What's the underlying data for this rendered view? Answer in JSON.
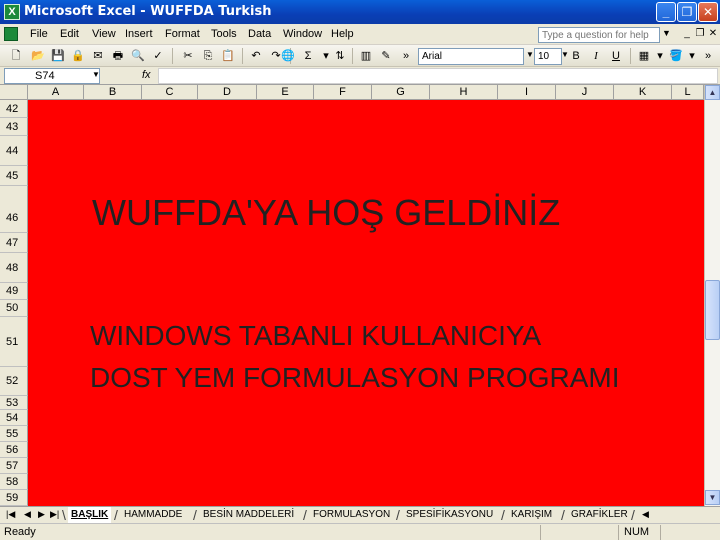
{
  "window": {
    "app_title": "Microsoft Excel",
    "document_title": "WUFFDA Turkish",
    "min_icon": "_",
    "restore_icon": "❐",
    "close_icon": "✕"
  },
  "menu": {
    "items": [
      "File",
      "Edit",
      "View",
      "Insert",
      "Format",
      "Tools",
      "Data",
      "Window",
      "Help"
    ],
    "help_placeholder": "Type a question for help"
  },
  "toolbar": {
    "font_name": "Arial",
    "font_size": "10",
    "bold": "B",
    "italic": "I",
    "underline": "U"
  },
  "formula_bar": {
    "name_box": "S74",
    "fx": "fx",
    "formula": ""
  },
  "grid": {
    "columns": [
      "A",
      "B",
      "C",
      "D",
      "E",
      "F",
      "G",
      "H",
      "I",
      "J",
      "K",
      "L"
    ],
    "rows": [
      "42",
      "43",
      "44",
      "45",
      "46",
      "47",
      "48",
      "49",
      "50",
      "51",
      "52",
      "53",
      "54",
      "55",
      "56",
      "57",
      "58",
      "59"
    ],
    "fill_color": "#ff0000"
  },
  "content": {
    "title": "WUFFDA'YA  HOŞ GELDİNİZ",
    "line1": "WINDOWS TABANLI KULLANICIYA",
    "line2": "DOST YEM FORMULASYON PROGRAMI"
  },
  "sheet_tabs": [
    "BAŞLIK",
    "HAMMADDE",
    "BESİN MADDELERİ",
    "FORMULASYON",
    "SPESİFİKASYONU",
    "KARIŞIM",
    "GRAFİKLER"
  ],
  "status": {
    "ready": "Ready",
    "num": "NUM"
  }
}
